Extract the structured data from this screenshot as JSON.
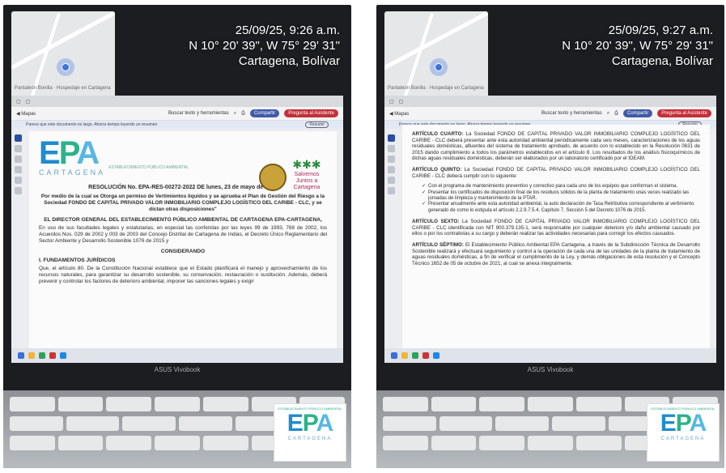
{
  "photos": [
    {
      "stamp": {
        "datetime": "25/09/25, 9:26 a.m.",
        "coords": "N 10° 20' 39\", W 75° 29' 31\"",
        "place": "Cartagena, Bolívar"
      },
      "laptop_brand": "ASUS Vivobook",
      "browser": {
        "back_label": "Mapas",
        "search_label": "Buscar texto y herramientas",
        "share_label": "Compartir",
        "ask_label": "Pregunta al Asistente"
      },
      "notice": "Parece que este documento es largo. Ahorra tiempo leyendo un resumen",
      "notice_pill": "Resumir",
      "document": {
        "logo_word": [
          "E",
          "P",
          "A"
        ],
        "logo_sub": "ESTABLECIMIENTO PÚBLICO AMBIENTAL",
        "logo_city": "CARTAGENA",
        "right_logo": "Salvemos Juntos a Cartagena",
        "resolution": "RESOLUCIÓN No. EPA-RES-00272-2022 DE lunes, 23 de mayo de 2022",
        "subject": "Por medio de la cual se Otorga un permiso de Vertimientos líquidos y se aprueba el Plan de Gestión del Riesgo a la Sociedad FONDO DE CAPITAL PRIVADO VALOR INMOBILIARIO COMPLEJO LOGÍSTICO DEL CARIBE - CLC, y se dictan otras disposiciones\"",
        "director": "EL DIRECTOR GENERAL DEL ESTABLECIMIENTO PÚBLICO AMBIENTAL DE CARTAGENA EPA-CARTAGENA,",
        "faculties": "En uso de sus facultades legales y estatutarias, en especial las conferidas por las leyes 99 de 1993, 768 de 2002, los Acuerdos Nos. 029 de 2002 y 003 de 2003 del Concejo Distrital de Cartagena de Indias, el Decreto Único Reglamentario del Sector Ambiente y Desarrollo Sostenible 1076 de 2015 y",
        "considerando": "CONSIDERANDO",
        "section": "I. FUNDAMENTOS JURÍDICOS",
        "fund_text": "Que, el artículo 80. De la Constitución Nacional establece que el Estado planificará el manejo y aprovechamiento de los recursos naturales, para garantizar su desarrollo sostenible, su conservación, restauración o sustitución. Además, deberá prevenir y controlar los factores de deterioro ambiental, imponer las sanciones legales y exigir"
      },
      "corner_logo": {
        "top": "ESTABLECIMIENTO PÚBLICO AMBIENTAL",
        "word": "EPA",
        "city": "CARTAGENA"
      }
    },
    {
      "stamp": {
        "datetime": "25/09/25, 9:27 a.m.",
        "coords": "N 10° 20' 39\", W 75° 29' 31\"",
        "place": "Cartagena, Bolívar"
      },
      "laptop_brand": "ASUS Vivobook",
      "browser": {
        "back_label": "Mapas",
        "search_label": "Buscar texto y herramientas",
        "share_label": "Compartir",
        "ask_label": "Pregunta al Asistente"
      },
      "notice": "Parece que este documento es largo. Ahorra tiempo leyendo un resumen",
      "notice_pill": "Resumir",
      "articles": [
        {
          "head": "ARTÍCULO CUARTO:",
          "text": "La Sociedad FONDO DE CAPITAL PRIVADO VALOR INMOBILIARIO COMPLEJO LOGÍSTICO DEL CARIBE - CLC deberá presentar ante esta autoridad ambiental periódicamente cada seis meses, caracterizaciones de los aguas residuales domésticas, afluentes del sistema de tratamiento aprobado, de acuerdo con lo establecido en la Resolución 0631 de 2015 dando cumplimiento a todos los parámetros establecidos en el artículo 8. Los resultados de los análisis fisicoquímicos de dichas aguas residuales domésticas, deberán ser elaborados por un laboratorio certificado por el IDEAM."
        },
        {
          "head": "ARTÍCULO QUINTO:",
          "text": "La Sociedad FONDO DE CAPITAL PRIVADO VALOR INMOBILIARIO COMPLEJO LOGÍSTICO DEL CARIBE - CLC deberá cumplir con lo siguiente:"
        }
      ],
      "checklist": [
        "Con el programa de mantenimiento preventivo y correctivo para cada uno de los equipos que conforman el sistema.",
        "Presentar los certificados de disposición final de los residuos sólidos de la planta de tratamiento unas veces realizado las jornadas de limpieza y mantenimiento de la PTAR.",
        "Presentar anualmente ante esta autoridad ambiental, la auto declaración de Tasa Retributiva correspondiente al vertimiento generado de como lo estipula el artículo 2.2.9.7.5.4. Capítulo 7, Sección 5 del Decreto 1076 de 2015."
      ],
      "articles2": [
        {
          "head": "ARTÍCULO SEXTO:",
          "text": "La Sociedad FONDO DE CAPITAL PRIVADO VALOR INMOBILIARIO COMPLEJO LOGÍSTICO DEL CARIBE - CLC identificada con NIT 900.379.135-1, será responsable por cualquier deterioro y/o daño ambiental causado por ellos o por los contratistas a su cargo y deberán realizar las actividades necesarias para corregir los efectos causados."
        },
        {
          "head": "ARTÍCULO SÉPTIMO:",
          "text": "El Establecimiento Público Ambiental EPA Cartagena, a través de la Subdirección Técnica de Desarrollo Sostenible realizará y efectuará seguimiento y control a la operación de cada una de las unidades de la planta de tratamiento de aguas residuales domésticas, a fin de verificar el cumplimiento de la Ley, y demás obligaciones de esta resolución y el Concepto Técnico 1652 de 05 de octubre de 2021, al cual se anexa integralmente."
        }
      ],
      "corner_logo": {
        "top": "ESTABLECIMIENTO PÚBLICO AMBIENTAL",
        "word": "EPA",
        "city": "CARTAGENA"
      }
    }
  ],
  "map_label": "Pantaleón Bonilla · Hospedaje en Cartagena"
}
